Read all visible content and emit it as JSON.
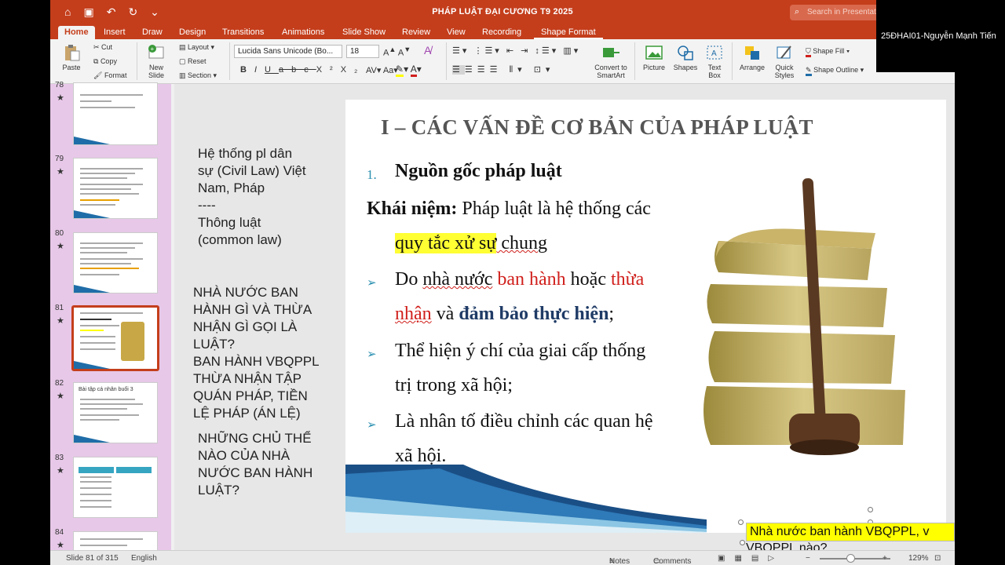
{
  "window": {
    "title": "PHÁP LUẬT ĐẠI CƯƠNG T9 2025",
    "search_placeholder": "Search in Presentation"
  },
  "tabs": [
    "Home",
    "Insert",
    "Draw",
    "Design",
    "Transitions",
    "Animations",
    "Slide Show",
    "Review",
    "View",
    "Recording",
    "Shape Format"
  ],
  "active_tab": "Home",
  "ribbon": {
    "paste": "Paste",
    "cut": "Cut",
    "copy": "Copy",
    "format": "Format",
    "new_slide": "New\nSlide",
    "layout": "Layout",
    "reset": "Reset",
    "section": "Section",
    "font": "Lucida Sans Unicode (Bo...",
    "size": "18",
    "convert": "Convert to\nSmartArt",
    "picture": "Picture",
    "shapes": "Shapes",
    "textbox": "Text\nBox",
    "arrange": "Arrange",
    "quick_styles": "Quick\nStyles",
    "shape_fill": "Shape Fill",
    "shape_outline": "Shape Outline"
  },
  "user_label": "25ĐHAI01-Nguyễn Mạnh Tiến",
  "thumbnails": [
    {
      "num": "78"
    },
    {
      "num": "79"
    },
    {
      "num": "80"
    },
    {
      "num": "81"
    },
    {
      "num": "82",
      "title": "Bài tập cá nhân buổi 3"
    },
    {
      "num": "83"
    },
    {
      "num": "84"
    }
  ],
  "notes": {
    "block1": "Hệ thống pl dân\nsự (Civil Law) Việt\nNam, Pháp\n----\nThông luật\n(common law)",
    "block2": "NHÀ NƯỚC BAN\nHÀNH GÌ VÀ THỪA\nNHẬN GÌ GỌI LÀ\nLUẬT?\nBAN HÀNH VBQPPL\nTHỪA NHẬN TẬP\nQUÁN PHÁP, TIỀN\nLỆ PHÁP (ÁN LỆ)",
    "block3": "NHỮNG CHỦ THỂ\nNÀO CỦA NHÀ\nNƯỚC BAN HÀNH\nLUẬT?"
  },
  "slide": {
    "title": "I – CÁC VẤN ĐỀ CƠ BẢN CỦA PHÁP LUẬT",
    "num": "1.",
    "heading": "Nguồn gốc pháp luật",
    "concept_label": "Khái niệm:",
    "concept_text": " Pháp luật là hệ thống các",
    "concept_hl": "quy tắc xử sự",
    "concept_end": " chung",
    "b1_a": "Do ",
    "b1_b": "nhà nước",
    "b1_c": " ",
    "b1_red1": "ban hành",
    "b1_d": " hoặc ",
    "b1_red2": "thừa",
    "b1_red3": "nhận",
    "b1_e": " và ",
    "b1_blue": "đảm bảo thực hiện",
    "b1_f": ";",
    "b2_1": "Thể hiện ý chí của giai cấp thống",
    "b2_2": "trị trong xã hội;",
    "b3_1": "Là nhân tố điều chỉnh các quan hệ",
    "b3_2": "xã hội."
  },
  "caption": {
    "line1": "Nhà nước ban hành VBQPPL, v",
    "line2": "VBQPPL nào?"
  },
  "status": {
    "slide": "Slide 81 of 315",
    "lang": "English",
    "notes": "Notes",
    "comments": "Comments",
    "zoom": "129%"
  }
}
